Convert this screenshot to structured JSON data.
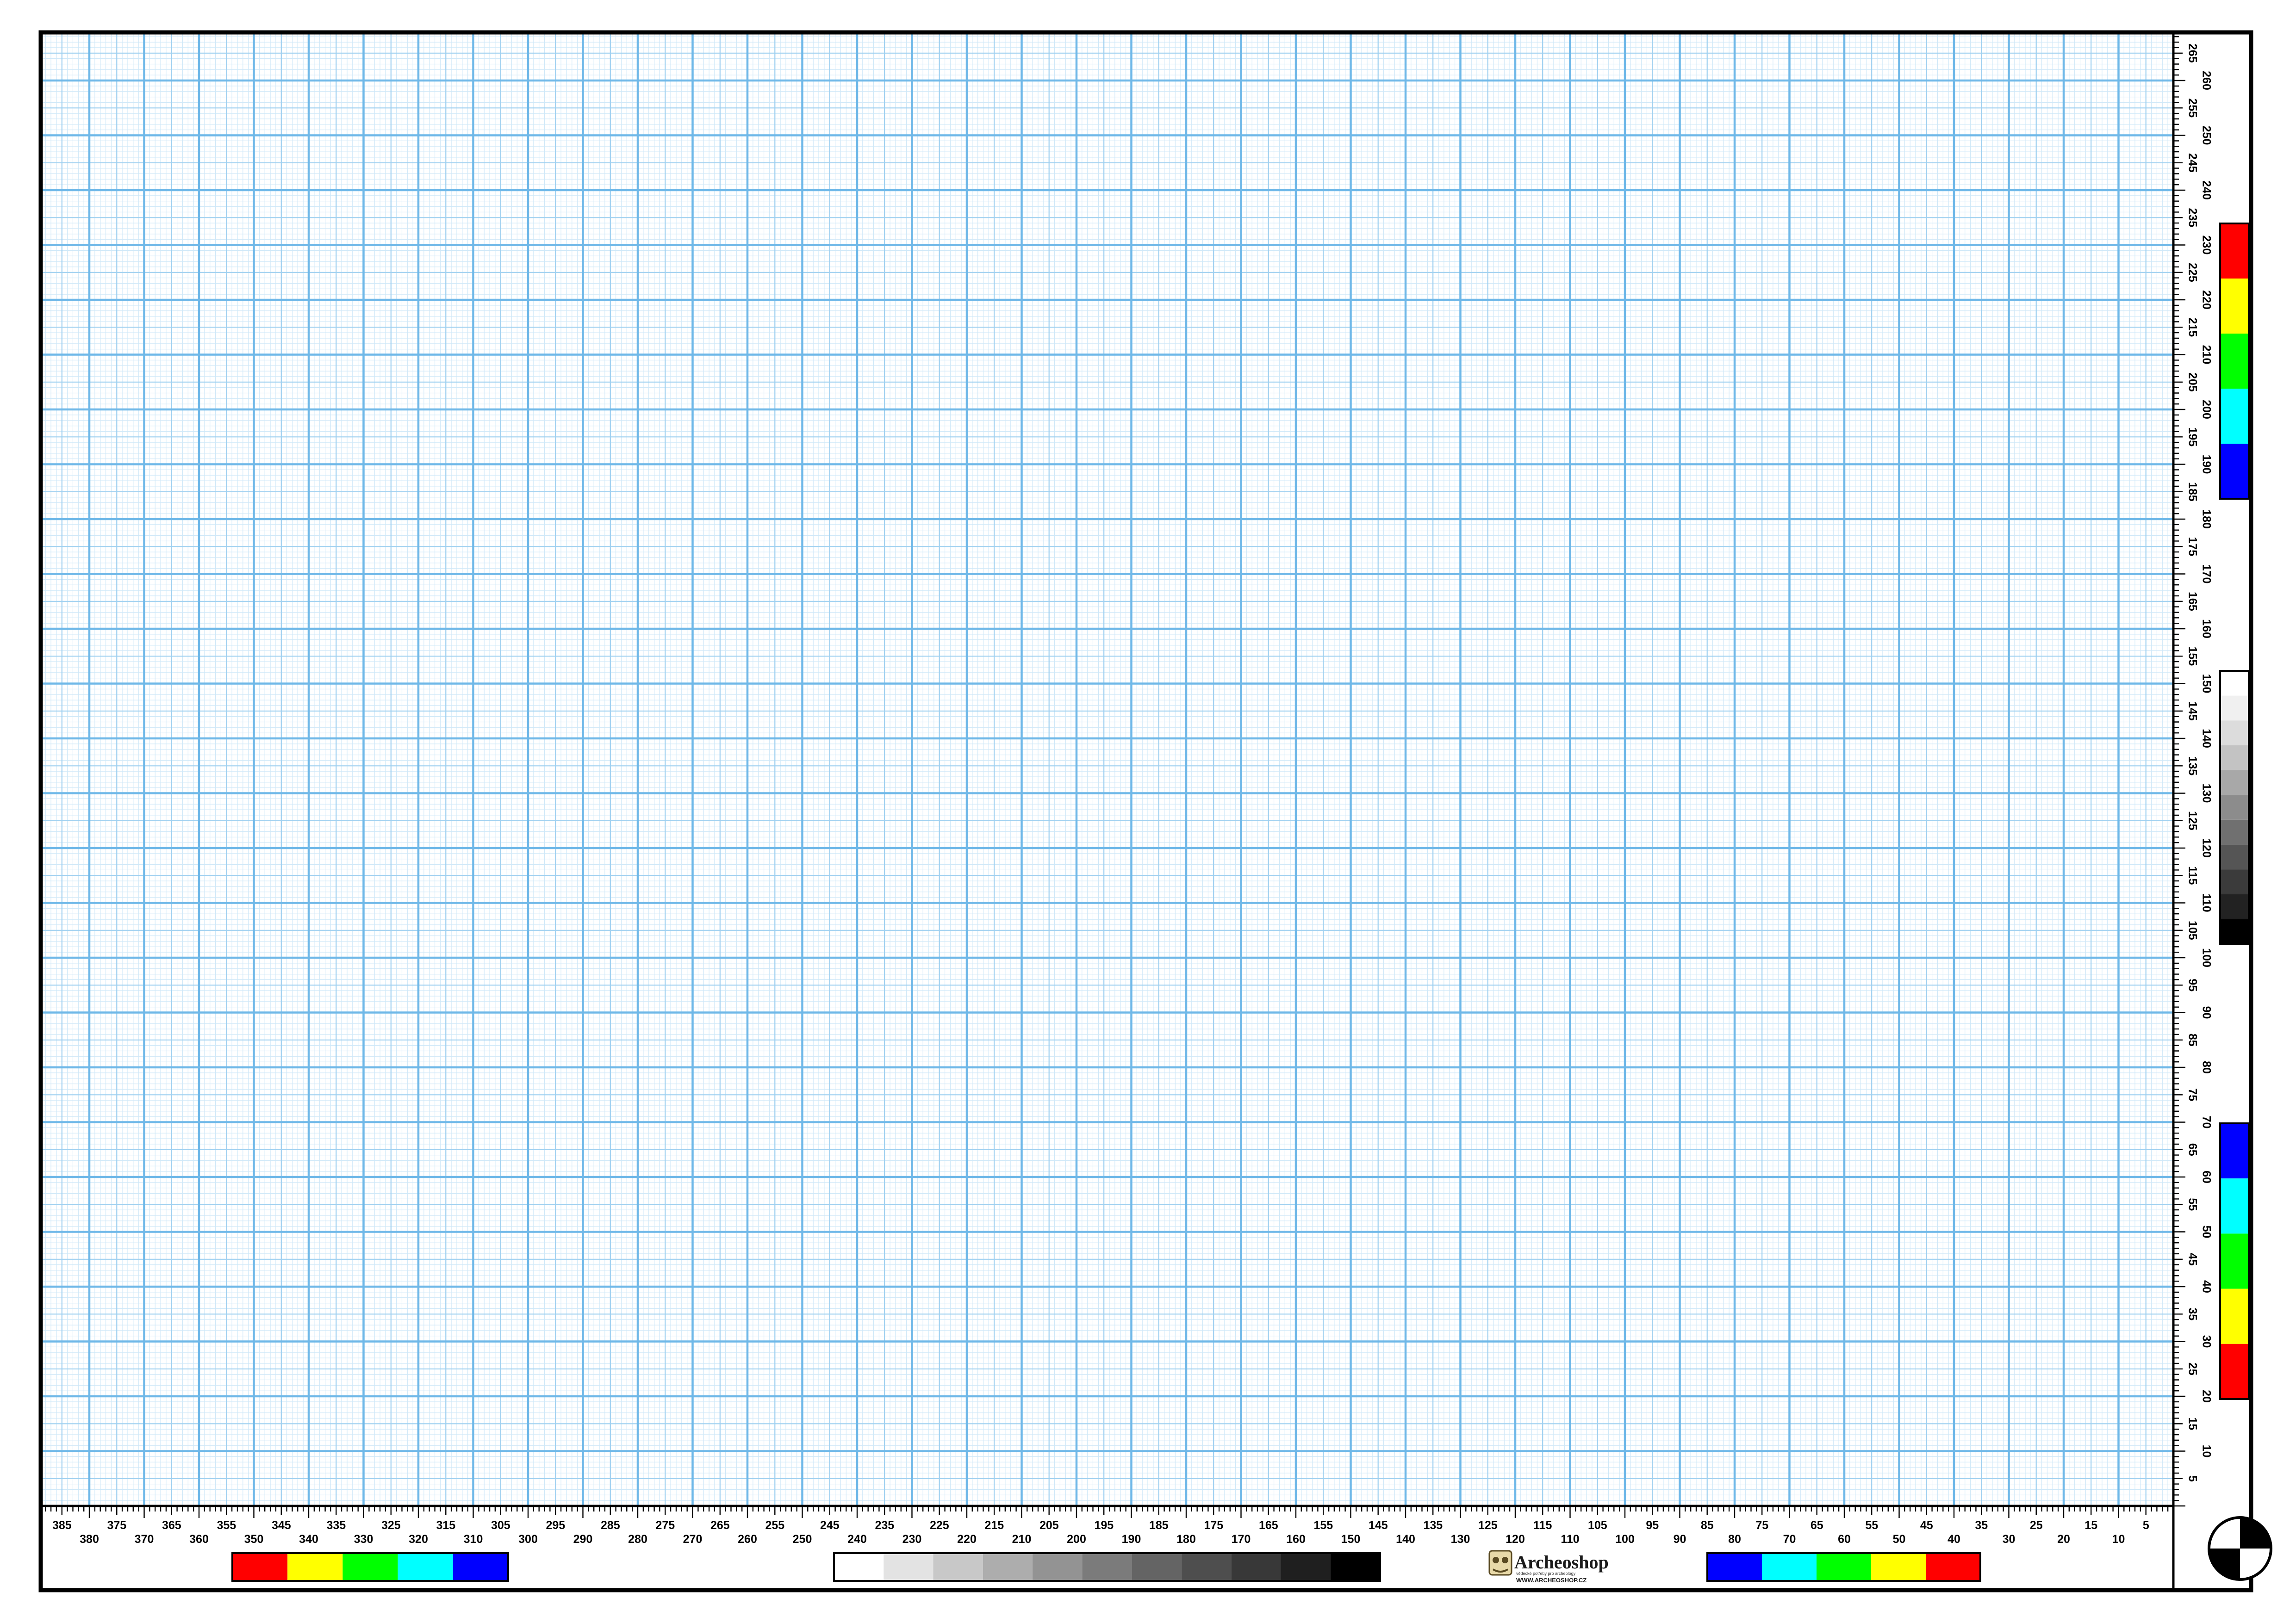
{
  "sheet": {
    "grid_color": "#6fb8e8",
    "frame_color": "#000000",
    "background": "#ffffff"
  },
  "bottom_scale": {
    "label_step": 5,
    "upper_labels": [
      385,
      375,
      365,
      355,
      345,
      335,
      325,
      315,
      305,
      295,
      285,
      275,
      265,
      255,
      245,
      235,
      225,
      215,
      205,
      195,
      185,
      175,
      165,
      155,
      145,
      135,
      125,
      115,
      105,
      95,
      85,
      75,
      65,
      55,
      45,
      35,
      25,
      15,
      5
    ],
    "lower_labels": [
      380,
      370,
      360,
      350,
      340,
      330,
      320,
      310,
      300,
      290,
      280,
      270,
      260,
      250,
      240,
      230,
      220,
      210,
      200,
      190,
      180,
      170,
      160,
      150,
      140,
      130,
      120,
      110,
      100,
      90,
      80,
      70,
      60,
      50,
      40,
      30,
      20,
      10
    ]
  },
  "side_scale": {
    "labels": [
      265,
      260,
      255,
      250,
      245,
      240,
      235,
      230,
      225,
      220,
      215,
      210,
      205,
      200,
      195,
      190,
      185,
      180,
      175,
      170,
      165,
      160,
      155,
      150,
      145,
      140,
      135,
      130,
      125,
      120,
      115,
      110,
      105,
      100,
      95,
      90,
      85,
      80,
      75,
      70,
      65,
      60,
      55,
      50,
      45,
      40,
      35,
      30,
      25,
      20,
      15,
      10,
      5
    ]
  },
  "color_bars": {
    "bottom_left": [
      "#ff0000",
      "#ffff00",
      "#00ff00",
      "#00ffff",
      "#0000ff"
    ],
    "bottom_right": [
      "#0000ff",
      "#00ffff",
      "#00ff00",
      "#ffff00",
      "#ff0000"
    ],
    "side_top": [
      "#ff0000",
      "#ffff00",
      "#00ff00",
      "#00ffff",
      "#0000ff"
    ],
    "side_bottom": [
      "#0000ff",
      "#00ffff",
      "#00ff00",
      "#ffff00",
      "#ff0000"
    ]
  },
  "gray_scale": {
    "bottom": [
      "#ffffff",
      "#e3e3e3",
      "#c8c8c8",
      "#adadad",
      "#939393",
      "#7b7b7b",
      "#646464",
      "#4e4e4e",
      "#383838",
      "#1f1f1f",
      "#000000"
    ],
    "side": [
      "#ffffff",
      "#f0f0f0",
      "#dcdcdc",
      "#c3c3c3",
      "#a8a8a8",
      "#8c8c8c",
      "#707070",
      "#555555",
      "#3b3b3b",
      "#222222",
      "#000000"
    ]
  },
  "logo": {
    "brand": "Archeoshop",
    "tagline": "vědecké potřeby pro archeology",
    "url": "WWW.ARCHEOSHOP.CZ"
  }
}
